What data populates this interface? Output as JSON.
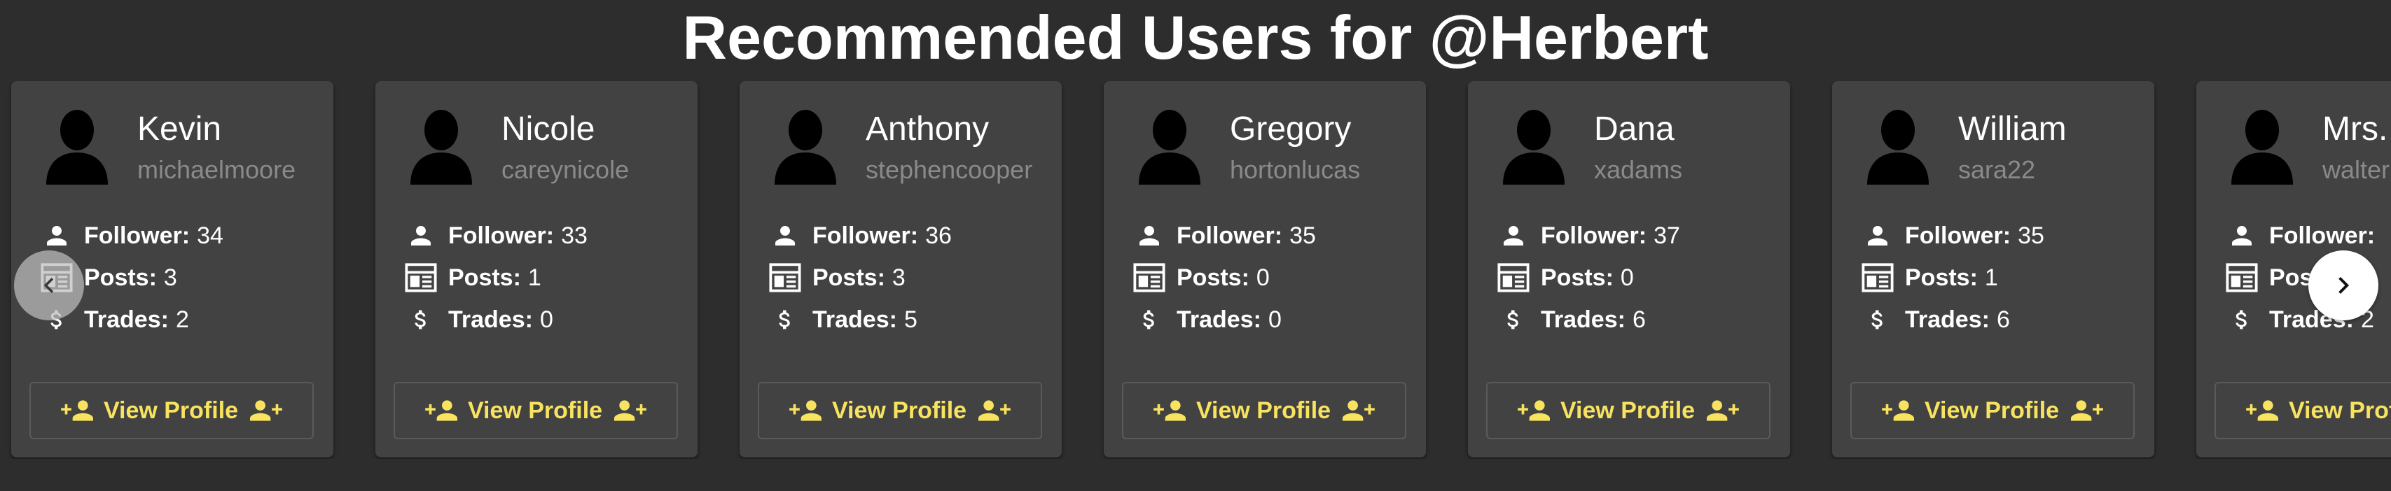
{
  "page": {
    "title": "Recommended Users for @Herbert"
  },
  "labels": {
    "followers": "Follower:",
    "posts": "Posts:",
    "trades": "Trades:",
    "view_profile": "View Profile"
  },
  "icons": {
    "avatar": "person-silhouette-icon",
    "followers": "person-icon",
    "posts": "newspaper-icon",
    "trades": "dollar-icon",
    "view_profile_left": "person-add-icon",
    "view_profile_right": "person-add-icon",
    "prev": "chevron-left-icon",
    "next": "chevron-right-icon"
  },
  "colors": {
    "background": "#2d2d2d",
    "card": "#424242",
    "accent": "#f7e35f",
    "muted_text": "#8a8a8a"
  },
  "users": [
    {
      "name": "Kevin",
      "username": "michaelmoore",
      "followers": "34",
      "posts": "3",
      "trades": "2"
    },
    {
      "name": "Nicole",
      "username": "careynicole",
      "followers": "33",
      "posts": "1",
      "trades": "0"
    },
    {
      "name": "Anthony",
      "username": "stephencooper",
      "followers": "36",
      "posts": "3",
      "trades": "5"
    },
    {
      "name": "Gregory",
      "username": "hortonlucas",
      "followers": "35",
      "posts": "0",
      "trades": "0"
    },
    {
      "name": "Dana",
      "username": "xadams",
      "followers": "37",
      "posts": "0",
      "trades": "6"
    },
    {
      "name": "William",
      "username": "sara22",
      "followers": "35",
      "posts": "1",
      "trades": "6"
    },
    {
      "name": "Mrs.",
      "username": "walter",
      "followers": "",
      "posts": "",
      "trades": "2"
    }
  ]
}
